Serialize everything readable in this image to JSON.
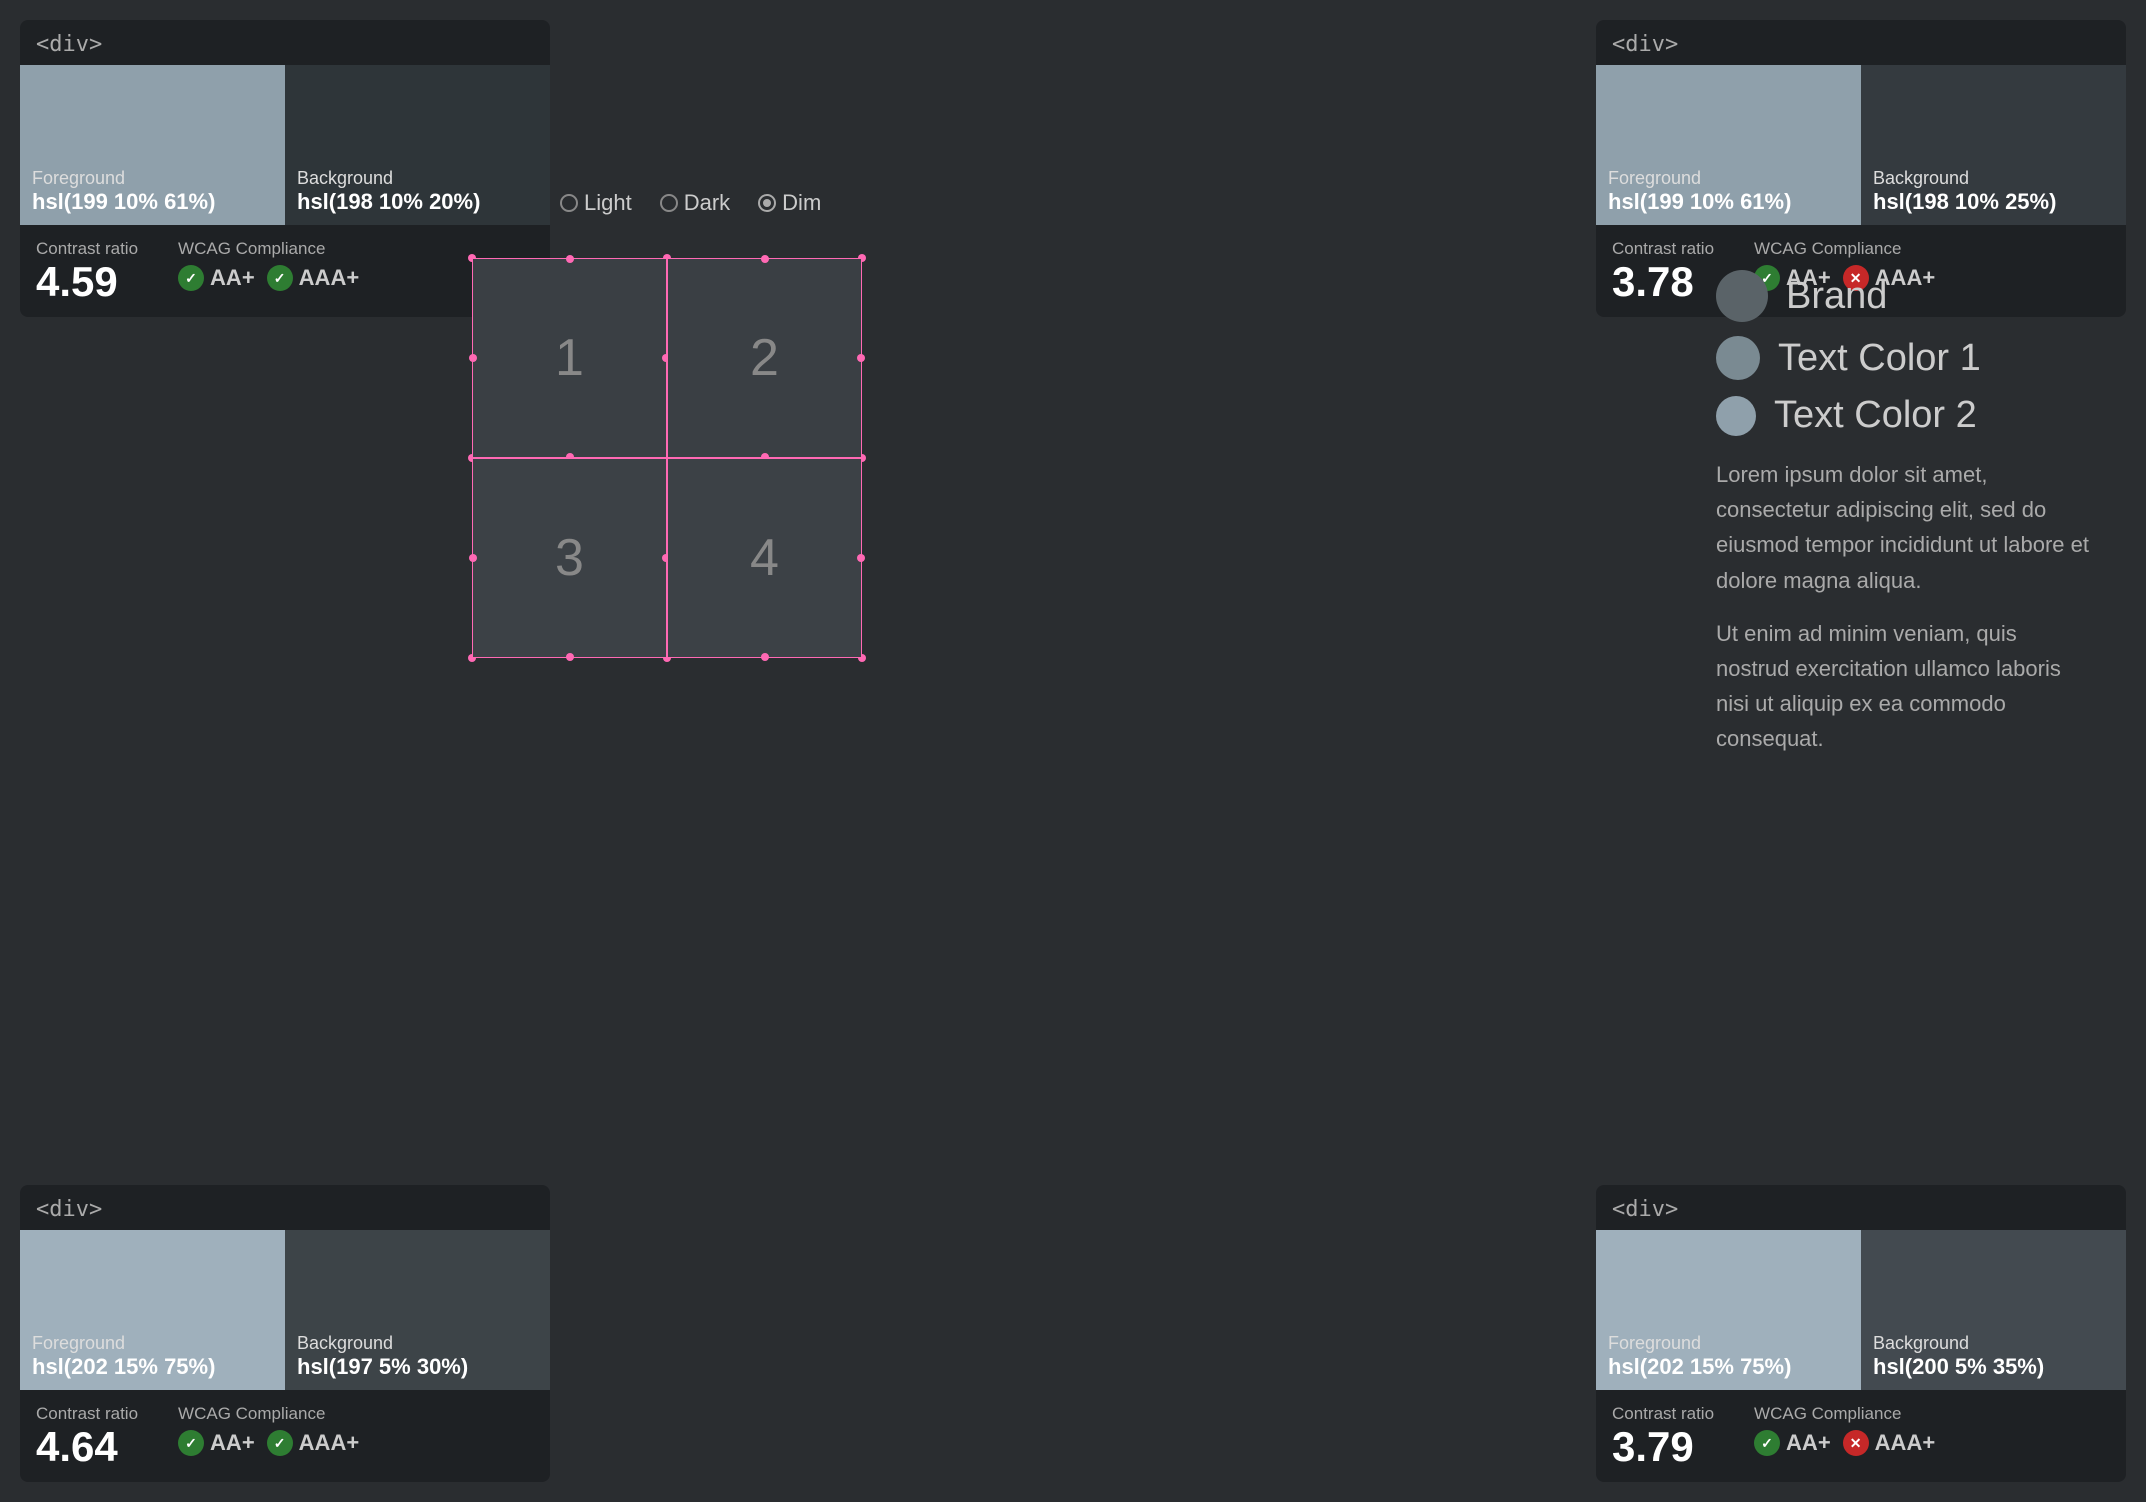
{
  "panels": {
    "top_left": {
      "tag": "<div>",
      "fg_label": "Foreground",
      "fg_value": "hsl(199 10% 61%)",
      "bg_label": "Background",
      "bg_value": "hsl(198 10% 20%)",
      "contrast_label": "Contrast ratio",
      "contrast_value": "4.59",
      "wcag_label": "WCAG Compliance",
      "aa_label": "AA+",
      "aaa_label": "AAA+",
      "aa_pass": true,
      "aaa_pass": true
    },
    "top_right": {
      "tag": "<div>",
      "fg_label": "Foreground",
      "fg_value": "hsl(199 10% 61%)",
      "bg_label": "Background",
      "bg_value": "hsl(198 10% 25%)",
      "contrast_label": "Contrast ratio",
      "contrast_value": "3.78",
      "wcag_label": "WCAG Compliance",
      "aa_label": "AA+",
      "aaa_label": "AAA+",
      "aa_pass": true,
      "aaa_pass": false
    },
    "bottom_left": {
      "tag": "<div>",
      "fg_label": "Foreground",
      "fg_value": "hsl(202 15% 75%)",
      "bg_label": "Background",
      "bg_value": "hsl(197 5% 30%)",
      "contrast_label": "Contrast ratio",
      "contrast_value": "4.64",
      "wcag_label": "WCAG Compliance",
      "aa_label": "AA+",
      "aaa_label": "AAA+",
      "aa_pass": true,
      "aaa_pass": true
    },
    "bottom_right": {
      "tag": "<div>",
      "fg_label": "Foreground",
      "fg_value": "hsl(202 15% 75%)",
      "bg_label": "Background",
      "bg_value": "hsl(200 5% 35%)",
      "contrast_label": "Contrast ratio",
      "contrast_value": "3.79",
      "wcag_label": "WCAG Compliance",
      "aa_label": "AA+",
      "aaa_label": "AAA+",
      "aa_pass": true,
      "aaa_pass": false
    }
  },
  "theme_selector": {
    "options": [
      {
        "label": "Light",
        "selected": false
      },
      {
        "label": "Dark",
        "selected": false
      },
      {
        "label": "Dim",
        "selected": true
      }
    ]
  },
  "grid": {
    "cells": [
      "1",
      "2",
      "3",
      "4"
    ]
  },
  "info_panel": {
    "legend": [
      {
        "label": "Brand",
        "size": 52,
        "color": "#5a6368"
      },
      {
        "label": "Text Color 1",
        "size": 44,
        "color": "#7a8a92"
      },
      {
        "label": "Text Color 2",
        "size": 40,
        "color": "#8fa0ab"
      }
    ],
    "lorem_paragraphs": [
      "Lorem ipsum dolor sit amet, consectetur adipiscing elit, sed do eiusmod tempor incididunt ut labore et dolore magna aliqua.",
      "Ut enim ad minim veniam, quis nostrud exercitation ullamco laboris nisi ut aliquip ex ea commodo consequat."
    ]
  }
}
